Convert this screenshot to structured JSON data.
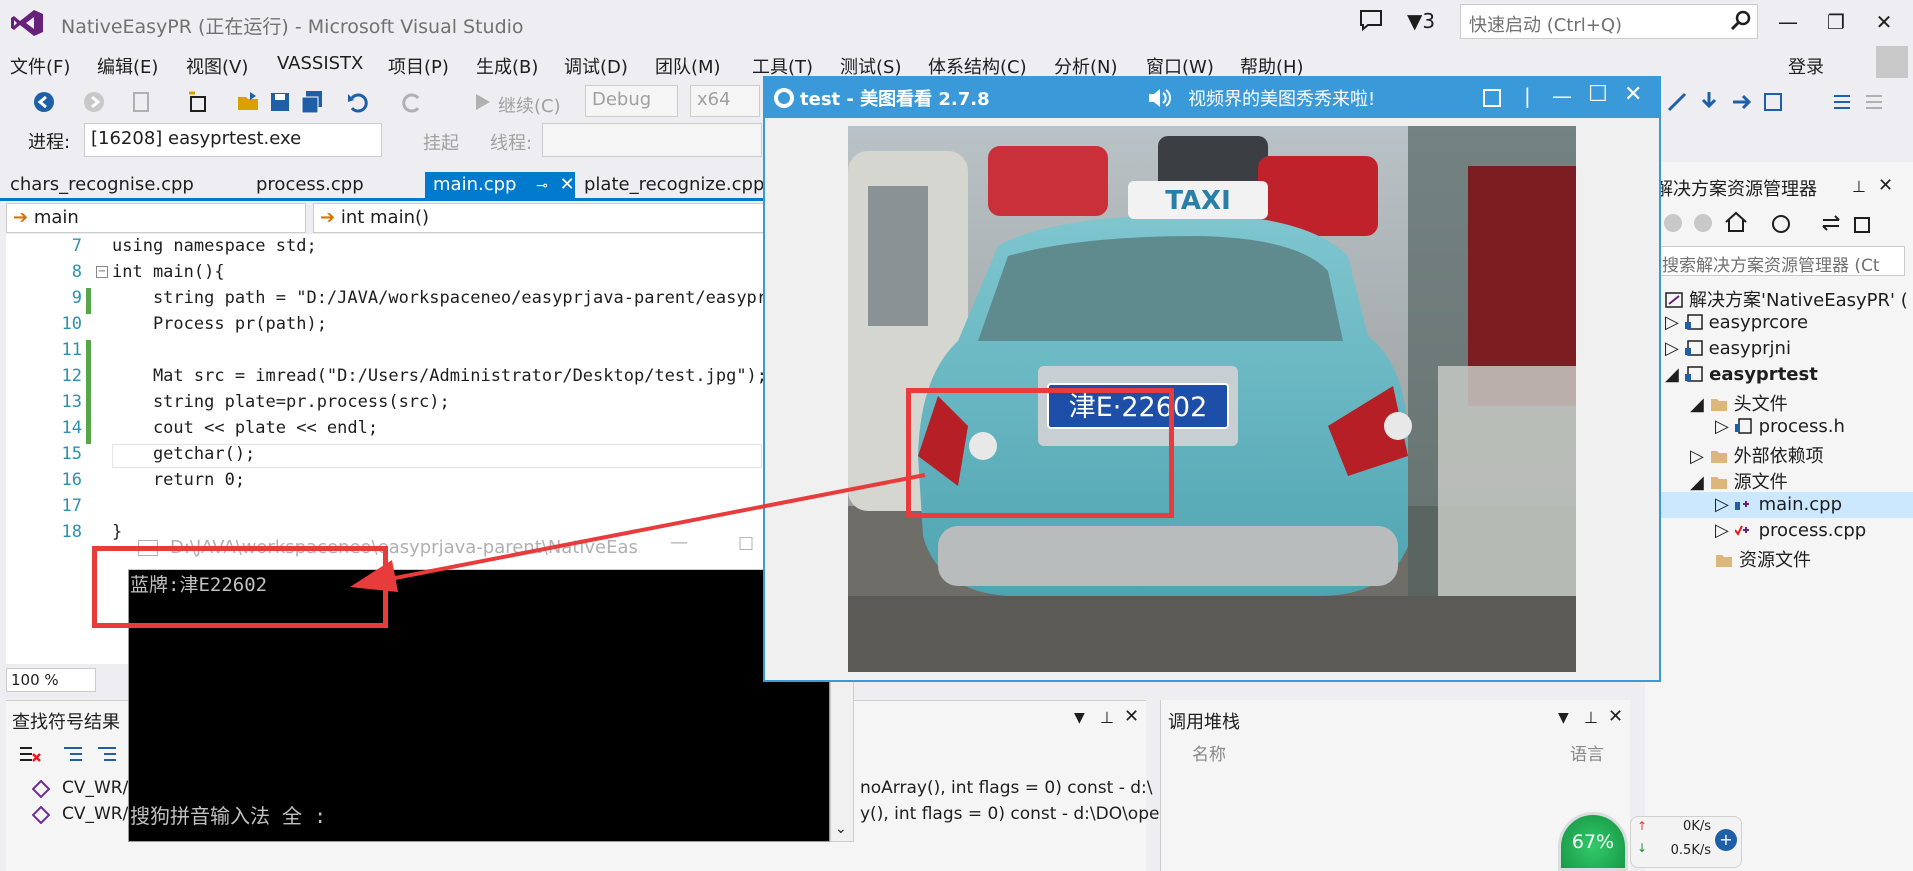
{
  "window": {
    "title": "NativeEasyPR (正在运行) - Microsoft Visual Studio",
    "notification_count": "3",
    "quick_launch_placeholder": "快速启动 (Ctrl+Q)",
    "login": "登录"
  },
  "menu": [
    "文件(F)",
    "编辑(E)",
    "视图(V)",
    "VASSISTX",
    "项目(P)",
    "生成(B)",
    "调试(D)",
    "团队(M)",
    "工具(T)",
    "测试(S)",
    "体系结构(C)",
    "分析(N)",
    "窗口(W)",
    "帮助(H)"
  ],
  "toolbar": {
    "continue_label": "继续(C)",
    "config": "Debug",
    "platform": "x64",
    "process_label": "进程:",
    "process_value": "[16208] easyprtest.exe",
    "suspend_label": "挂起",
    "thread_label": "线程:"
  },
  "tabs": [
    "chars_recognise.cpp",
    "process.cpp",
    "main.cpp",
    "plate_recognize.cpp"
  ],
  "navbar": {
    "scope": "main",
    "member": "int main()"
  },
  "code": {
    "line_numbers": [
      "7",
      "8",
      "9",
      "10",
      "11",
      "12",
      "13",
      "14",
      "15",
      "16",
      "17",
      "18"
    ],
    "lines": [
      "using namespace std;",
      "int main(){",
      "    string path = \"D:/JAVA/workspaceneo/easyprjava-parent/easyprj",
      "    Process pr(path);",
      "",
      "    Mat src = imread(\"D:/Users/Administrator/Desktop/test.jpg\");",
      "    string plate=pr.process(src);",
      "    cout << plate << endl;",
      "    getchar();",
      "    return 0;",
      "",
      "}"
    ]
  },
  "editor": {
    "zoom": "100 %"
  },
  "console": {
    "title": "D:\\JAVA\\workspaceneo\\easyprjava-parent\\NativeEas...",
    "output": "蓝牌:津E22602",
    "ime": "搜狗拼音输入法 全 :"
  },
  "viewer": {
    "title": "test - 美图看看 2.7.8",
    "ad_text": "视频界的美图秀秀来啦!",
    "taxi_sign": "TAXI",
    "plate": "津E·22602"
  },
  "find_panel": {
    "title": "查找符号结果",
    "rows": [
      {
        "left": "CV_WR/",
        "right": "noArray(), int flags = 0) const - d:\\"
      },
      {
        "left": "CV_WR/",
        "right": "y(), int flags = 0) const - d:\\DO\\ope"
      }
    ]
  },
  "call_stack": {
    "title": "调用堆栈",
    "col_name": "名称",
    "col_lang": "语言"
  },
  "solution_explorer": {
    "title": "解决方案资源管理器",
    "search_placeholder": "搜索解决方案资源管理器 (Ct",
    "items": [
      {
        "label": "解决方案'NativeEasyPR' ("
      },
      {
        "label": "easyprcore"
      },
      {
        "label": "easyprjni"
      },
      {
        "label": "easyprtest"
      },
      {
        "label": "头文件"
      },
      {
        "label": "process.h"
      },
      {
        "label": "外部依赖项"
      },
      {
        "label": "源文件"
      },
      {
        "label": "main.cpp"
      },
      {
        "label": "process.cpp"
      },
      {
        "label": "资源文件"
      }
    ]
  },
  "net_widget": {
    "cpu": "67%",
    "up": "0K/s",
    "down": "0.5K/s"
  },
  "colors": {
    "accent": "#007acc",
    "viewer": "#3a9ad9",
    "annotation": "#e83b3b"
  }
}
